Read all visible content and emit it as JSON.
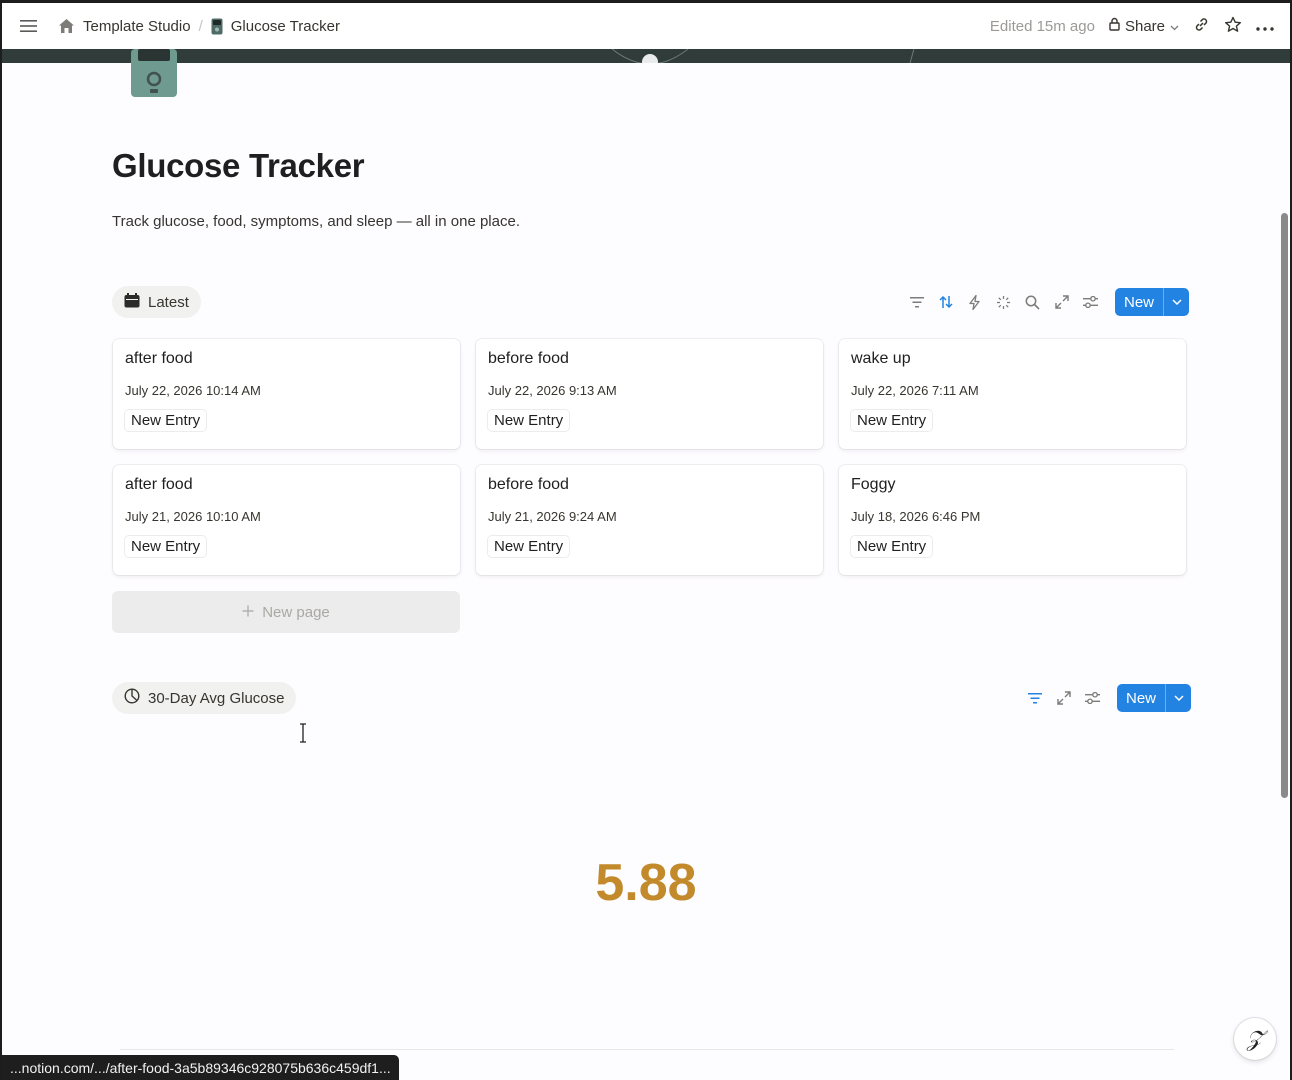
{
  "topbar": {
    "breadcrumb": [
      {
        "label": "Template Studio",
        "icon": "home-icon"
      },
      {
        "label": "Glucose Tracker",
        "icon": "glucose-meter-icon"
      }
    ],
    "edited": "Edited 15m ago",
    "share_label": "Share"
  },
  "page": {
    "title": "Glucose Tracker",
    "description": "Track glucose, food, symptoms, and sleep — all in one place."
  },
  "latest_view": {
    "tab_label": "Latest",
    "new_label": "New",
    "cards": [
      {
        "title": "after food",
        "date": "July 22, 2026 10:14 AM",
        "tag": "New Entry"
      },
      {
        "title": "before food",
        "date": "July 22, 2026 9:13 AM",
        "tag": "New Entry"
      },
      {
        "title": "wake up",
        "date": "July 22, 2026 7:11 AM",
        "tag": "New Entry"
      },
      {
        "title": "after food",
        "date": "July 21, 2026 10:10 AM",
        "tag": "New Entry"
      },
      {
        "title": "before food",
        "date": "July 21, 2026 9:24 AM",
        "tag": "New Entry"
      },
      {
        "title": "Foggy",
        "date": "July 18, 2026 6:46 PM",
        "tag": "New Entry"
      }
    ],
    "new_page_label": "New page"
  },
  "avg_view": {
    "tab_label": "30-Day Avg Glucose",
    "new_label": "New",
    "value": "5.88",
    "value_color": "#c28a2b"
  },
  "statusbar": {
    "url": "...notion.com/.../after-food-3a5b89346c928075b636c459df1..."
  },
  "colors": {
    "accent": "#2383e2",
    "cover": "#2f3c3a"
  }
}
